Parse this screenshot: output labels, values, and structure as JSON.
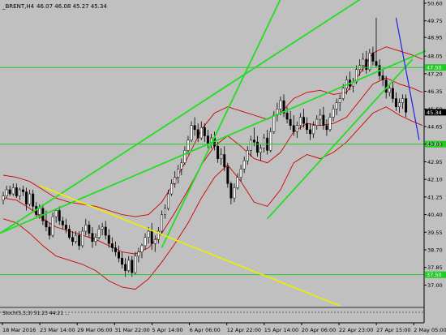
{
  "header": {
    "symbol": "_BRENT,H4",
    "ohlc": "46.07 46.08 45.27 45.34"
  },
  "colors": {
    "background": "#c0c0c0",
    "candle": "#000000",
    "bollinger": "#d00000",
    "trendline_green": "#22dd22",
    "trendline_yellow": "#eeee00",
    "trendline_blue": "#2222dd",
    "hline": "#22cc22",
    "axis_tag_bg": "#22cc22"
  },
  "chart_data": {
    "type": "candlestick",
    "title": "_BRENT,H4",
    "ylim": [
      36.0,
      50.6
    ],
    "y_ticks": [
      "50.60",
      "49.75",
      "48.95",
      "48.05",
      "47.20",
      "46.35",
      "45.50",
      "44.65",
      "43.80",
      "42.95",
      "42.10",
      "41.25",
      "40.40",
      "39.55",
      "38.70",
      "37.85",
      "37.00"
    ],
    "x_ticks": [
      "18 Mar 2016",
      "23 Mar 14:00",
      "29 Mar 06:00",
      "31 Mar 22:00",
      "5 Apr 14:00",
      "6 Apr 06:00",
      "12 Apr 22:00",
      "15 Apr 14:00",
      "20 Apr 06:00",
      "22 Apr 23:00",
      "27 Apr 15:00",
      "2 May 05:00"
    ],
    "current_price": "45.34",
    "horizontal_levels": [
      "47.50",
      "43.80",
      "37.50"
    ],
    "bar_count": 128,
    "candles": [
      [
        41.1,
        41.5,
        40.9,
        41.3
      ],
      [
        41.3,
        41.8,
        41.2,
        41.6
      ],
      [
        41.6,
        41.8,
        41.3,
        41.4
      ],
      [
        41.4,
        41.9,
        41.3,
        41.7
      ],
      [
        41.7,
        41.9,
        41.2,
        41.3
      ],
      [
        41.3,
        41.7,
        41.1,
        41.6
      ],
      [
        41.6,
        41.8,
        41.3,
        41.5
      ],
      [
        41.5,
        41.7,
        40.6,
        40.9
      ],
      [
        40.9,
        41.6,
        40.8,
        41.4
      ],
      [
        41.4,
        41.6,
        40.6,
        40.8
      ],
      [
        40.8,
        41.0,
        40.3,
        40.4
      ],
      [
        40.4,
        40.9,
        40.2,
        40.7
      ],
      [
        40.7,
        40.9,
        39.9,
        40.1
      ],
      [
        40.1,
        40.6,
        39.6,
        39.8
      ],
      [
        39.8,
        40.0,
        39.2,
        39.4
      ],
      [
        39.4,
        40.5,
        39.3,
        40.3
      ],
      [
        40.3,
        40.7,
        40.0,
        40.6
      ],
      [
        40.6,
        40.8,
        39.9,
        40.1
      ],
      [
        40.1,
        40.3,
        39.7,
        39.9
      ],
      [
        39.9,
        40.2,
        39.5,
        39.7
      ],
      [
        39.7,
        39.9,
        39.2,
        39.3
      ],
      [
        39.3,
        39.6,
        38.9,
        39.1
      ],
      [
        39.1,
        39.6,
        39.0,
        39.4
      ],
      [
        39.4,
        39.6,
        38.7,
        38.9
      ],
      [
        38.9,
        39.8,
        38.8,
        39.6
      ],
      [
        39.6,
        40.2,
        39.4,
        39.9
      ],
      [
        39.9,
        40.1,
        39.3,
        39.5
      ],
      [
        39.5,
        39.8,
        38.8,
        39.1
      ],
      [
        39.1,
        39.5,
        38.9,
        39.3
      ],
      [
        39.3,
        39.9,
        39.2,
        39.7
      ],
      [
        39.7,
        40.0,
        39.4,
        39.8
      ],
      [
        39.8,
        40.1,
        39.2,
        39.4
      ],
      [
        39.4,
        39.7,
        38.8,
        39.0
      ],
      [
        39.0,
        39.3,
        38.6,
        38.8
      ],
      [
        38.8,
        39.1,
        38.4,
        38.6
      ],
      [
        38.6,
        38.9,
        38.1,
        38.3
      ],
      [
        38.3,
        38.6,
        37.8,
        38.0
      ],
      [
        38.0,
        38.3,
        37.4,
        37.7
      ],
      [
        37.7,
        38.4,
        37.6,
        38.2
      ],
      [
        38.2,
        38.4,
        37.4,
        37.6
      ],
      [
        37.6,
        38.6,
        37.5,
        38.4
      ],
      [
        38.4,
        38.8,
        38.1,
        38.6
      ],
      [
        38.6,
        39.0,
        38.3,
        38.9
      ],
      [
        38.9,
        39.5,
        38.7,
        39.3
      ],
      [
        39.3,
        39.8,
        39.0,
        39.6
      ],
      [
        39.6,
        40.0,
        38.7,
        39.0
      ],
      [
        39.0,
        39.4,
        38.6,
        39.2
      ],
      [
        39.2,
        39.8,
        39.0,
        39.6
      ],
      [
        39.6,
        40.6,
        39.5,
        40.4
      ],
      [
        40.4,
        40.9,
        40.2,
        40.7
      ],
      [
        40.7,
        41.6,
        40.6,
        41.4
      ],
      [
        41.4,
        42.1,
        41.3,
        41.9
      ],
      [
        41.9,
        42.5,
        41.7,
        42.2
      ],
      [
        42.2,
        42.8,
        41.9,
        42.6
      ],
      [
        42.6,
        43.1,
        42.3,
        42.9
      ],
      [
        42.9,
        43.7,
        42.8,
        43.5
      ],
      [
        43.5,
        44.2,
        43.3,
        44.0
      ],
      [
        44.0,
        44.9,
        43.9,
        44.7
      ],
      [
        44.7,
        45.1,
        44.2,
        44.5
      ],
      [
        44.5,
        44.8,
        43.9,
        44.1
      ],
      [
        44.1,
        44.9,
        44.0,
        44.6
      ],
      [
        44.6,
        44.8,
        43.9,
        44.2
      ],
      [
        44.2,
        44.5,
        43.6,
        43.8
      ],
      [
        43.8,
        44.3,
        43.6,
        44.1
      ],
      [
        44.1,
        44.4,
        43.5,
        43.7
      ],
      [
        43.7,
        43.9,
        42.9,
        43.1
      ],
      [
        43.1,
        43.6,
        42.8,
        43.3
      ],
      [
        43.3,
        43.7,
        42.5,
        42.7
      ],
      [
        42.7,
        42.9,
        41.7,
        41.9
      ],
      [
        41.9,
        42.0,
        40.9,
        41.2
      ],
      [
        41.2,
        41.9,
        41.0,
        41.7
      ],
      [
        41.7,
        42.4,
        41.6,
        42.2
      ],
      [
        42.2,
        42.8,
        42.0,
        42.6
      ],
      [
        42.6,
        43.2,
        42.4,
        43.0
      ],
      [
        43.0,
        43.7,
        42.8,
        43.5
      ],
      [
        43.5,
        44.2,
        43.2,
        44.0
      ],
      [
        44.0,
        44.6,
        43.7,
        43.9
      ],
      [
        43.9,
        44.2,
        43.2,
        43.4
      ],
      [
        43.4,
        43.8,
        43.0,
        43.6
      ],
      [
        43.6,
        44.3,
        43.4,
        44.1
      ],
      [
        44.1,
        44.5,
        43.3,
        43.5
      ],
      [
        43.5,
        44.6,
        43.4,
        44.4
      ],
      [
        44.4,
        45.4,
        44.3,
        45.2
      ],
      [
        45.2,
        45.8,
        44.9,
        45.5
      ],
      [
        45.5,
        46.1,
        45.2,
        45.9
      ],
      [
        45.9,
        46.2,
        45.1,
        45.3
      ],
      [
        45.3,
        45.6,
        44.8,
        45.0
      ],
      [
        45.0,
        45.4,
        44.5,
        44.7
      ],
      [
        44.7,
        45.2,
        44.2,
        44.4
      ],
      [
        44.4,
        44.9,
        44.1,
        44.7
      ],
      [
        44.7,
        45.3,
        44.5,
        45.1
      ],
      [
        45.1,
        45.5,
        44.6,
        44.8
      ],
      [
        44.8,
        45.1,
        44.3,
        44.5
      ],
      [
        44.5,
        44.8,
        44.0,
        44.3
      ],
      [
        44.3,
        44.9,
        44.1,
        44.7
      ],
      [
        44.7,
        45.2,
        44.5,
        45.0
      ],
      [
        45.0,
        45.5,
        44.7,
        45.2
      ],
      [
        45.2,
        45.6,
        44.5,
        44.7
      ],
      [
        44.7,
        45.0,
        44.2,
        44.5
      ],
      [
        44.5,
        45.3,
        44.4,
        45.1
      ],
      [
        45.1,
        45.7,
        44.9,
        45.5
      ],
      [
        45.5,
        46.0,
        45.2,
        45.8
      ],
      [
        45.8,
        46.2,
        45.4,
        46.0
      ],
      [
        46.0,
        46.7,
        45.9,
        46.5
      ],
      [
        46.5,
        47.1,
        46.2,
        46.9
      ],
      [
        46.9,
        47.3,
        46.4,
        46.6
      ],
      [
        46.6,
        47.0,
        46.3,
        46.8
      ],
      [
        46.8,
        47.6,
        46.7,
        47.4
      ],
      [
        47.4,
        47.9,
        47.1,
        47.6
      ],
      [
        47.6,
        48.2,
        47.3,
        47.9
      ],
      [
        47.9,
        48.3,
        47.2,
        47.4
      ],
      [
        47.4,
        48.4,
        47.3,
        48.2
      ],
      [
        48.2,
        48.5,
        47.6,
        47.8
      ],
      [
        47.8,
        49.9,
        47.5,
        47.6
      ],
      [
        47.6,
        47.9,
        46.9,
        47.1
      ],
      [
        47.1,
        47.4,
        46.6,
        46.9
      ],
      [
        46.9,
        47.1,
        46.0,
        46.3
      ],
      [
        46.3,
        46.7,
        46.1,
        46.5
      ],
      [
        46.5,
        46.8,
        45.8,
        46.0
      ],
      [
        46.0,
        46.3,
        45.4,
        45.6
      ],
      [
        45.6,
        46.0,
        45.3,
        45.8
      ],
      [
        45.8,
        46.2,
        45.5,
        46.0
      ],
      [
        46.0,
        46.2,
        45.1,
        45.34
      ]
    ],
    "bands_step": 4,
    "upper_band": [
      42.3,
      42.2,
      42.0,
      41.6,
      41.2,
      41.0,
      40.9,
      40.8,
      40.6,
      40.4,
      40.3,
      40.4,
      41.0,
      42.0,
      43.2,
      44.5,
      45.3,
      45.6,
      45.4,
      45.2,
      45.0,
      45.3,
      46.0,
      46.3,
      46.4,
      46.2,
      46.3,
      47.2,
      48.2,
      48.5,
      48.3,
      48.1,
      47.9
    ],
    "lower_band": [
      40.2,
      40.0,
      39.5,
      38.9,
      38.4,
      38.2,
      38.0,
      37.7,
      37.2,
      36.9,
      36.8,
      37.3,
      38.1,
      39.0,
      40.0,
      41.2,
      42.2,
      42.8,
      42.0,
      41.0,
      40.8,
      41.6,
      42.9,
      43.3,
      43.1,
      43.4,
      43.9,
      44.6,
      45.3,
      45.6,
      45.2,
      44.9,
      44.7
    ],
    "mid_band": [
      41.2,
      41.1,
      40.7,
      40.2,
      39.8,
      39.6,
      39.4,
      39.2,
      38.9,
      38.6,
      38.5,
      38.8,
      39.5,
      40.5,
      41.6,
      42.8,
      43.7,
      44.2,
      43.7,
      43.1,
      42.9,
      43.4,
      44.4,
      44.8,
      44.7,
      44.8,
      45.1,
      45.9,
      46.7,
      47.0,
      46.7,
      46.5,
      46.3
    ],
    "oscillator_label": "Stoch(5,3,3) 51.23 44.21 ..."
  }
}
